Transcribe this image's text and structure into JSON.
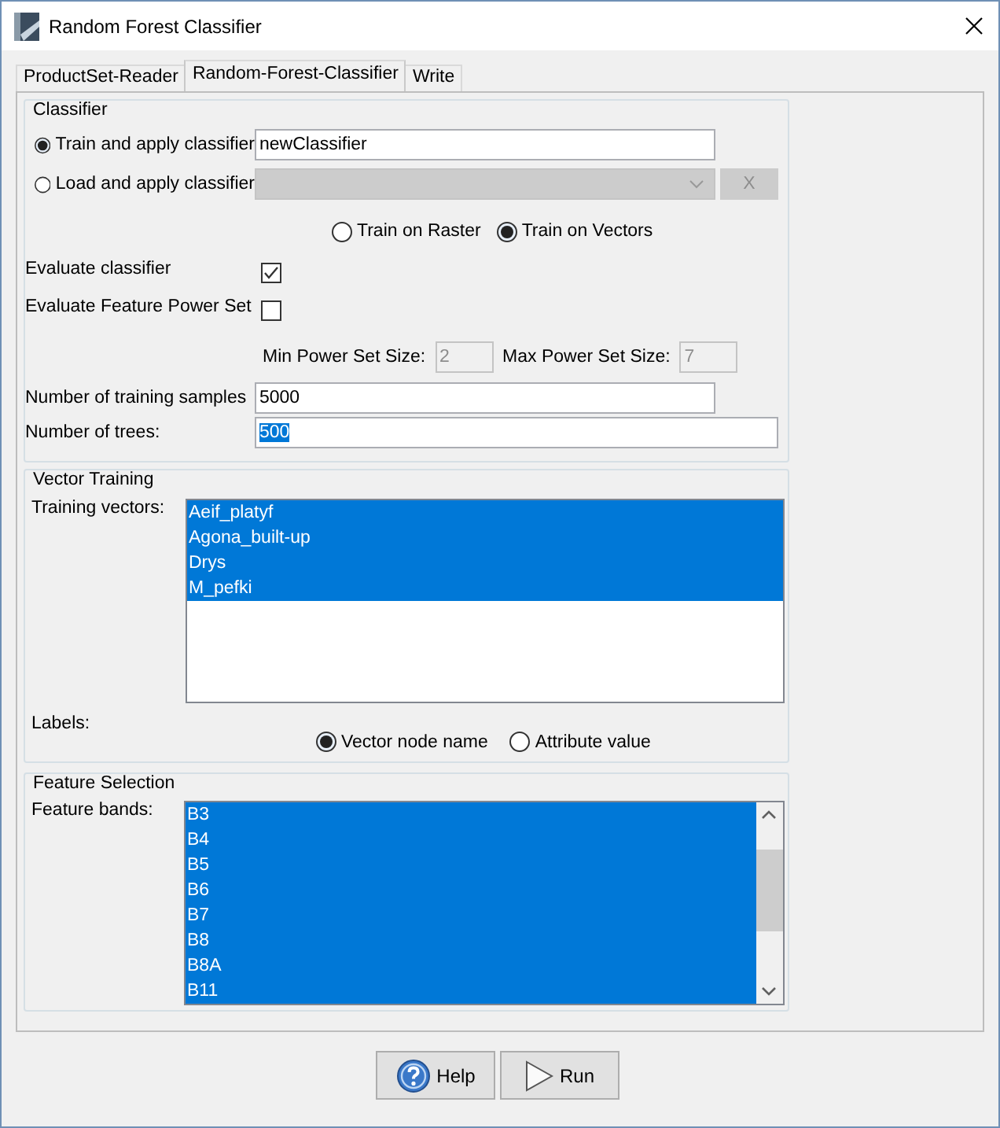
{
  "window": {
    "title": "Random Forest Classifier"
  },
  "tabs": [
    {
      "label": "ProductSet-Reader",
      "selected": false
    },
    {
      "label": "Random-Forest-Classifier",
      "selected": true
    },
    {
      "label": "Write",
      "selected": false
    }
  ],
  "classifier": {
    "title": "Classifier",
    "modes": [
      {
        "label": "Train and apply classifier",
        "selected": true,
        "kind": "text",
        "value": "newClassifier",
        "disabled": false
      },
      {
        "label": "Load and apply classifier",
        "selected": false,
        "kind": "dropdown",
        "disabled": true,
        "button": "X"
      }
    ],
    "train_on": [
      {
        "label": "Train on Raster",
        "selected": false
      },
      {
        "label": "Train on Vectors",
        "selected": true
      }
    ],
    "checks": [
      {
        "label": "Evaluate classifier",
        "checked": true
      },
      {
        "label": "Evaluate Feature Power Set",
        "checked": false
      }
    ],
    "power_set": [
      {
        "label": "Min Power Set Size:",
        "value": "2",
        "disabled": true
      },
      {
        "label": "Max Power Set Size:",
        "value": "7",
        "disabled": true
      }
    ],
    "fields": [
      {
        "label": "Number of training samples",
        "value": "5000",
        "text_selected": false
      },
      {
        "label": "Number of trees:",
        "value": "500",
        "text_selected": true
      }
    ]
  },
  "vector_training": {
    "title": "Vector Training",
    "list_label": "Training vectors:",
    "vectors": [
      {
        "label": "Aeif_platyf",
        "selected": true
      },
      {
        "label": "Agona_built-up",
        "selected": true
      },
      {
        "label": "Drys",
        "selected": true
      },
      {
        "label": "M_pefki",
        "selected": true
      }
    ],
    "labels_label": "Labels:",
    "label_options": [
      {
        "label": "Vector node name",
        "selected": true
      },
      {
        "label": "Attribute value",
        "selected": false
      }
    ]
  },
  "feature_selection": {
    "title": "Feature Selection",
    "list_label": "Feature bands:",
    "bands": [
      {
        "label": "B3",
        "selected": true
      },
      {
        "label": "B4",
        "selected": true
      },
      {
        "label": "B5",
        "selected": true
      },
      {
        "label": "B6",
        "selected": true
      },
      {
        "label": "B7",
        "selected": true
      },
      {
        "label": "B8",
        "selected": true
      },
      {
        "label": "B8A",
        "selected": true
      },
      {
        "label": "B11",
        "selected": true
      }
    ]
  },
  "buttons": [
    {
      "label": "Help",
      "kind": "help"
    },
    {
      "label": "Run",
      "kind": "run"
    }
  ]
}
